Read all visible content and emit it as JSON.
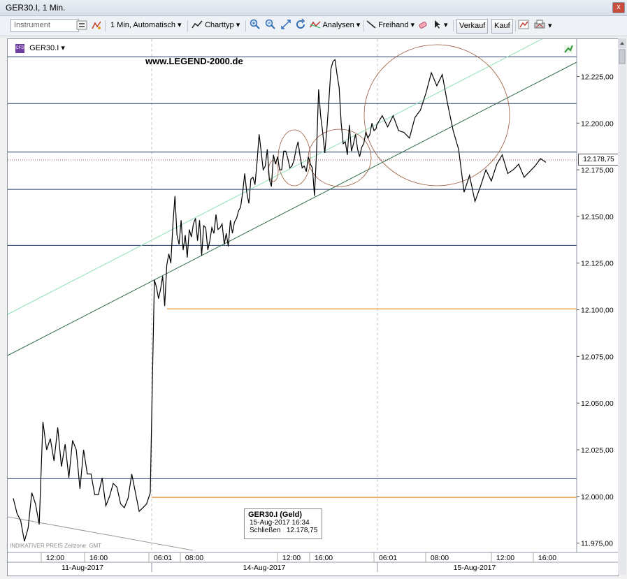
{
  "window": {
    "title": "GER30.I, 1 Min.",
    "close_label": "x"
  },
  "toolbar": {
    "instrument_placeholder": "Instrument",
    "interval_label": "1 Min, Automatisch",
    "charttype_label": "Charttyp",
    "analysen_label": "Analysen",
    "freihand_label": "Freihand",
    "verkauf_label": "Verkauf",
    "kauf_label": "Kauf"
  },
  "chart_header": {
    "instrument": "GER30.I",
    "badge": "CFD",
    "website": "www.LEGEND-2000.de"
  },
  "footer_note": "INDIKATIVER PREIS   Zeitzone: GMT",
  "tooltip": {
    "title": "GER30.I (Geld)",
    "datetime": "15-Aug-2017 16:34",
    "close_label": "Schließen",
    "close_value": "12.178,75"
  },
  "last_price_label": "12.178,75",
  "colors": {
    "price": "#000000",
    "hline": "#2a3d66",
    "orange": "#ee8a2d",
    "trend_dark": "#2f6b45",
    "trend_light": "#8fe0b5",
    "circle": "#9b5a3c"
  },
  "chart_data": {
    "type": "line",
    "ylim": [
      11970,
      12245
    ],
    "y_ticks": [
      "12.225,00",
      "12.200,00",
      "12.175,00",
      "12.150,00",
      "12.125,00",
      "12.100,00",
      "12.075,00",
      "12.050,00",
      "12.025,00",
      "12.000,00",
      "11.975,00"
    ],
    "x_ticks": [
      "12:00",
      "16:00",
      "06:01",
      "08:00",
      "12:00",
      "16:00",
      "06:01",
      "08:00",
      "12:00",
      "16:00"
    ],
    "dates": [
      "11-Aug-2017",
      "14-Aug-2017",
      "15-Aug-2017"
    ],
    "last_close": 12178.75,
    "horizontal_levels": [
      12235.5,
      12210.5,
      12184.5,
      12164.5,
      12134.5,
      12009.5
    ],
    "orange_levels": [
      12100.5,
      11999.5
    ],
    "series": [
      {
        "values": [
          11999,
          11991,
          11987,
          11976,
          11983,
          12002,
          11996,
          11985,
          12040,
          12025,
          12031,
          12019,
          12037,
          12016,
          12028,
          12010,
          12030,
          12025,
          12004,
          12025,
          12012,
          12012,
          12001,
          12001,
          12010,
          11995,
          12000,
          12007,
          12005,
          11996,
          11994,
          11999,
          12012,
          12002,
          11992,
          11994,
          11996,
          12002,
          12062,
          12116,
          12112,
          12106,
          12111,
          12118,
          12102,
          12124,
          12130,
          12125,
          12146,
          12161,
          12140,
          12135,
          12148,
          12132,
          12140,
          12128,
          12143,
          12139,
          12146,
          12149,
          12137,
          12148,
          12129,
          12145,
          12144,
          12132,
          12137,
          12144,
          12141,
          12151,
          12143,
          12144,
          12146,
          12135,
          12141,
          12134,
          12148,
          12141,
          12147,
          12149,
          12153,
          12155,
          12163,
          12173,
          12163,
          12157,
          12170,
          12171,
          12167,
          12179,
          12194,
          12185,
          12175,
          12177,
          12186,
          12170,
          12166,
          12183,
          12178,
          12182,
          12175,
          12175,
          12185,
          12185,
          12181,
          12176,
          12177,
          12180,
          12186,
          12190,
          12182,
          12176,
          12177,
          12174,
          12182,
          12178,
          12176,
          12161,
          12185,
          12218,
          12204,
          12195,
          12184,
          12196,
          12212,
          12229,
          12233,
          12234,
          12226,
          12219,
          12200,
          12189,
          12190,
          12183,
          12199,
          12185,
          12189,
          12194,
          12186,
          12182,
          12187,
          12189,
          12195,
          12192,
          12194,
          12200,
          12196,
          12197,
          12199,
          12204,
          12198,
          12204,
          12196,
          12195,
          12192,
          12203,
          12207,
          12216,
          12227,
          12220,
          12226,
          12210,
          12196,
          12186,
          12163,
          12172,
          12158,
          12166,
          12175,
          12169,
          12178,
          12183,
          12173,
          12175,
          12178,
          12171,
          12174,
          12177,
          12181,
          12179
        ]
      }
    ]
  }
}
